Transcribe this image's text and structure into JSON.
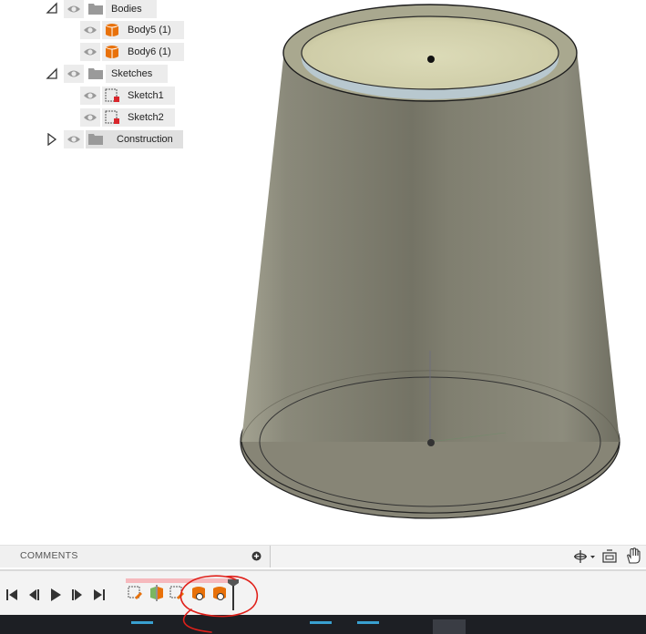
{
  "browser": {
    "items": [
      {
        "label": "Bodies",
        "type": "folder",
        "expander": "expanded-icon"
      },
      {
        "label": "Body5 (1)",
        "type": "body"
      },
      {
        "label": "Body6 (1)",
        "type": "body"
      },
      {
        "label": "Sketches",
        "type": "folder",
        "expander": "expanded-icon"
      },
      {
        "label": "Sketch1",
        "type": "sketch"
      },
      {
        "label": "Sketch2",
        "type": "sketch"
      },
      {
        "label": "Construction",
        "type": "folder",
        "expander": "collapsed-icon"
      }
    ]
  },
  "comments": {
    "label": "COMMENTS"
  },
  "nav_tools": [
    "orbit-icon",
    "look-at-icon",
    "pan-icon"
  ],
  "timeline": {
    "controls": [
      "go-to-start-icon",
      "step-back-icon",
      "play-icon",
      "step-forward-icon",
      "go-to-end-icon"
    ],
    "features": [
      "sketch-feature-icon",
      "split-body-icon",
      "sketch-feature-icon",
      "body-feature-icon",
      "body-feature-icon"
    ]
  },
  "colors": {
    "accent": "#e8710a",
    "timeline_track": "#f6b9bd",
    "body_fill": "#7a7866",
    "annotation": "#e0201a"
  }
}
